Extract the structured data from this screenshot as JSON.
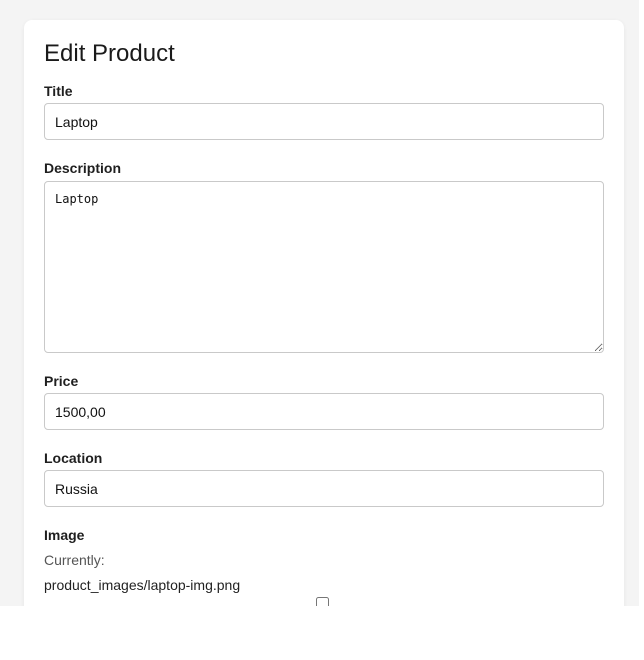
{
  "form": {
    "heading": "Edit Product",
    "title": {
      "label": "Title",
      "value": "Laptop"
    },
    "description": {
      "label": "Description",
      "value": "Laptop"
    },
    "price": {
      "label": "Price",
      "value": "1500,00"
    },
    "location": {
      "label": "Location",
      "value": "Russia"
    },
    "image": {
      "label": "Image",
      "currently_label": "Currently:",
      "current_file": "product_images/laptop-img.png"
    }
  },
  "colors": {
    "page_background": "#f4f4f4",
    "card_background": "#ffffff",
    "input_border": "#c9c9c9"
  }
}
